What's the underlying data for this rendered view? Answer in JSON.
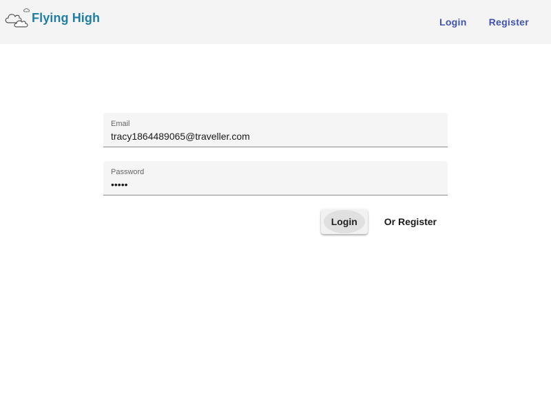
{
  "header": {
    "logo_text": "Flying High",
    "nav": {
      "login_label": "Login",
      "register_label": "Register"
    }
  },
  "form": {
    "email": {
      "label": "Email",
      "value": "tracy1864489065@traveller.com"
    },
    "password": {
      "label": "Password",
      "value": "•••••"
    },
    "login_button_label": "Login",
    "register_button_label": "Or Register"
  },
  "colors": {
    "brand": "#1f7ea6",
    "nav_link": "#3f51b5",
    "topbar_bg": "#f4f4f4",
    "field_bg": "#f5f5f5"
  }
}
